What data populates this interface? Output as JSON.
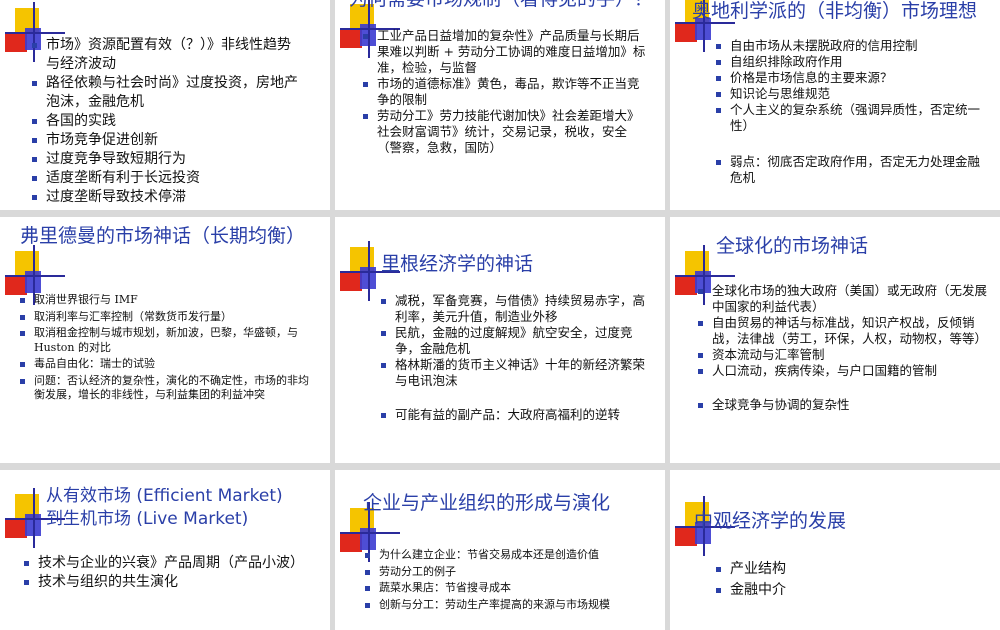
{
  "slides": [
    {
      "title": "",
      "items": [
        "市场》资源配置有效（？）》非线性趋势与经济波动",
        "路径依赖与社会时尚》过度投资，房地产泡沫，金融危机",
        "各国的实践",
        "市场竞争促进创新",
        "过度竞争导致短期行为",
        "适度垄断有利于长远投资",
        "过度垄断导致技术停滞"
      ]
    },
    {
      "title": "为何需要市场规制（看得见的手）？",
      "items": [
        "工业产品日益增加的复杂性》产品质量与长期后果难以判断 + 劳动分工协调的难度日益增加》标准，检验，与监督",
        "市场的道德标准》黄色，毒品，欺诈等不正当竞争的限制",
        "劳动分工》劳力技能代谢加快》社会差距增大》社会财富调节》统计，交易记录，税收，安全（警察，急救，国防）"
      ]
    },
    {
      "title": "奥地利学派的（非均衡）市场理想",
      "items": [
        "自由市场从未摆脱政府的信用控制",
        "自组织排除政府作用",
        "价格是市场信息的主要来源？",
        "知识论与思维规范",
        "个人主义的复杂系统（强调异质性，否定统一性）",
        "弱点：彻底否定政府作用，否定无力处理金融危机"
      ]
    },
    {
      "title": "弗里德曼的市场神话（长期均衡）",
      "items": [
        "取消世界银行与 IMF",
        "取消利率与汇率控制（常数货币发行量）",
        "取消租金控制与城市规划，新加波，巴黎，华盛顿，与 Huston 的对比",
        "毒品自由化：瑞士的试验",
        "问题：否认经济的复杂性，演化的不确定性，市场的非均衡发展，增长的非线性，与利益集团的利益冲突"
      ]
    },
    {
      "title": "里根经济学的神话",
      "items": [
        "减税，军备竞赛，与借债》持续贸易赤字，高利率，美元升值，制造业外移",
        "民航，金融的过度解规》航空安全，过度竞争，金融危机",
        "格林斯潘的货币主义神话》十年的新经济繁荣与电讯泡沫",
        "可能有益的副产品：大政府高福利的逆转"
      ]
    },
    {
      "title": "全球化的市场神话",
      "items": [
        "全球化市场的独大政府（美国）或无政府（无发展中国家的利益代表）",
        "自由贸易的神话与标准战，知识产权战，反倾销战，法律战（劳工，环保，人权，动物权，等等）",
        "资本流动与汇率管制",
        "人口流动，疾病传染，与户口国籍的管制",
        "全球竞争与协调的复杂性"
      ]
    },
    {
      "title_line1": "从有效市场 (Efficient Market)",
      "title_line2": "到生机市场 (Live Market)",
      "items": [
        "技术与企业的兴衰》产品周期（产品小波）",
        "技术与组织的共生演化"
      ]
    },
    {
      "title": "企业与产业组织的形成与演化",
      "items": [
        "为什么建立企业：节省交易成本还是创造价值",
        "劳动分工的例子",
        "蔬菜水果店：节省搜寻成本",
        "创新与分工：劳动生产率提高的来源与市场规模"
      ]
    },
    {
      "title": "中观经济学的发展",
      "items": [
        "产业结构",
        "金融中介"
      ]
    }
  ]
}
